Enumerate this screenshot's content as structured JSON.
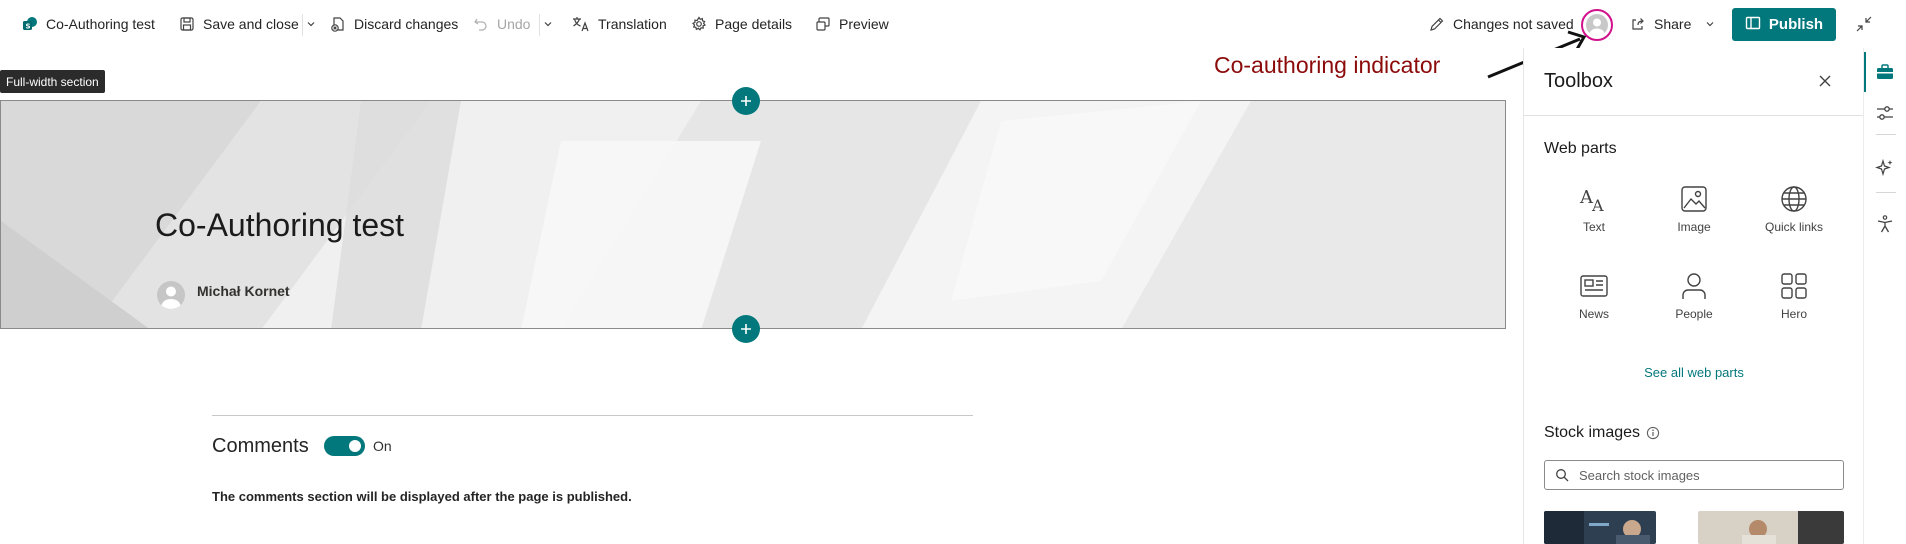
{
  "cmdbar": {
    "page_name": "Co-Authoring test",
    "save_close": "Save and close",
    "discard": "Discard changes",
    "undo": "Undo",
    "translation": "Translation",
    "page_details": "Page details",
    "preview": "Preview",
    "changes_status": "Changes not saved",
    "share": "Share",
    "publish": "Publish"
  },
  "annotation": "Co-authoring indicator",
  "canvas": {
    "section_tooltip": "Full-width section",
    "hero_title": "Co-Authoring test",
    "author": "Michał Kornet"
  },
  "comments": {
    "title": "Comments",
    "toggle_state": "On",
    "note": "The comments section will be displayed after the page is published."
  },
  "toolbox": {
    "title": "Toolbox",
    "web_parts_heading": "Web parts",
    "web_parts": [
      {
        "label": "Text",
        "icon": "text-icon"
      },
      {
        "label": "Image",
        "icon": "image-icon"
      },
      {
        "label": "Quick links",
        "icon": "globe-icon"
      },
      {
        "label": "News",
        "icon": "news-icon"
      },
      {
        "label": "People",
        "icon": "person-icon"
      },
      {
        "label": "Hero",
        "icon": "hero-grid-icon"
      }
    ],
    "see_all": "See all web parts",
    "stock_heading": "Stock images",
    "search_placeholder": "Search stock images"
  },
  "colors": {
    "accent": "#03787c",
    "coauthor_ring": "#d1118b",
    "annotation": "#8b0a0a"
  }
}
